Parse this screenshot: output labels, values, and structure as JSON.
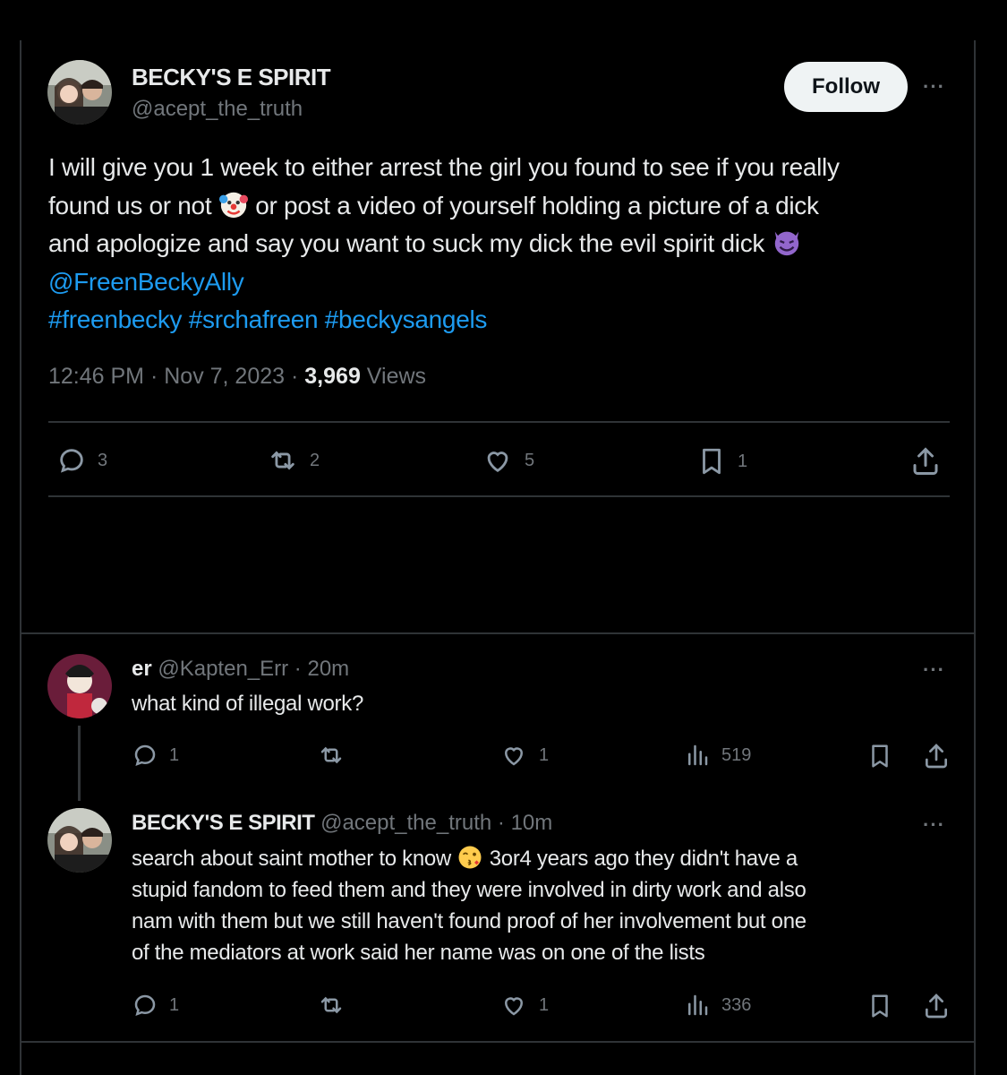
{
  "main_tweet": {
    "author_name": "BECKY'S E SPIRIT",
    "author_handle": "@acept_the_truth",
    "follow_label": "Follow",
    "text_line1": "I will give you 1 week to either arrest the girl you found to see if you really",
    "text_line2a": "found us or not",
    "text_line2b": "or post a video of yourself holding a picture of a dick",
    "text_line3": "and apologize and say you want to suck my dick the evil spirit dick",
    "mention": "@FreenBeckyAlly",
    "hashtags": "#freenbecky #srchafreen #beckysangels",
    "time": "12:46 PM",
    "date": "Nov 7, 2023",
    "views_count": "3,969",
    "views_label": "Views",
    "stats": {
      "replies": "3",
      "reposts": "2",
      "likes": "5",
      "bookmarks": "1"
    }
  },
  "replies": [
    {
      "author_name": "er",
      "author_handle": "@Kapten_Err",
      "age": "20m",
      "text": "what kind of illegal work?",
      "stats": {
        "replies": "1",
        "likes": "1",
        "views": "519"
      }
    },
    {
      "author_name": "BECKY'S E SPIRIT",
      "author_handle": "@acept_the_truth",
      "age": "10m",
      "text_line1a": "search about saint mother to know",
      "text_line1b": "3or4 years ago they didn't have a",
      "text_line2": "stupid fandom to feed them and they were involved in dirty work and also",
      "text_line3": "nam with them but we still haven't found proof of her involvement but one",
      "text_line4": "of the mediators at work said her name was on one of the lists",
      "stats": {
        "replies": "1",
        "likes": "1",
        "views": "336"
      }
    }
  ],
  "icons": {
    "more": "more-icon",
    "reply": "reply-icon",
    "repost": "repost-icon",
    "like": "heart-icon",
    "bookmark": "bookmark-icon",
    "share": "share-icon",
    "views": "views-icon",
    "clown": "clown-face-emoji",
    "devil": "smiling-devil-emoji",
    "kiss": "kissing-face-emoji"
  },
  "colors": {
    "background": "#000000",
    "text": "#e7e9ea",
    "secondary": "#71767b",
    "link": "#1d9bf0",
    "border": "#2f3336",
    "follow_bg": "#eff3f4"
  }
}
